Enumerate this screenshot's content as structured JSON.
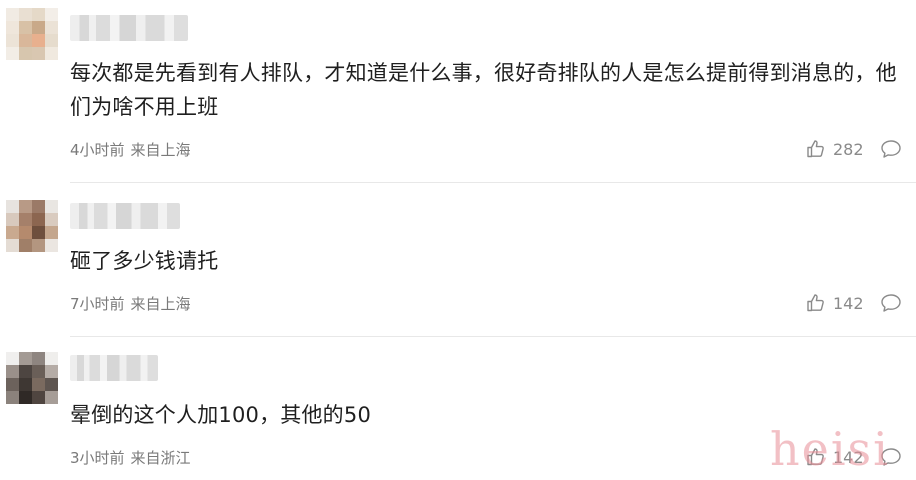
{
  "comments": [
    {
      "text": "每次都是先看到有人排队，才知道是什么事，很好奇排队的人是怎么提前得到消息的，他们为啥不用上班",
      "time": "4小时前",
      "location": "来自上海",
      "likes": "282"
    },
    {
      "text": "砸了多少钱请托",
      "time": "7小时前",
      "location": "来自上海",
      "likes": "142"
    },
    {
      "text": "晕倒的这个人加100，其他的50",
      "time": "3小时前",
      "location": "来自浙江",
      "likes": "142"
    }
  ],
  "watermark": "heisi",
  "icons": {
    "like": "thumbs-up-icon",
    "reply": "comment-bubble-icon"
  },
  "colors": {
    "text": "#1f1f1f",
    "meta": "#7a7a7a",
    "icon": "#8a8a8a",
    "divider": "#e8e8e8",
    "watermark": "#e88c96"
  }
}
